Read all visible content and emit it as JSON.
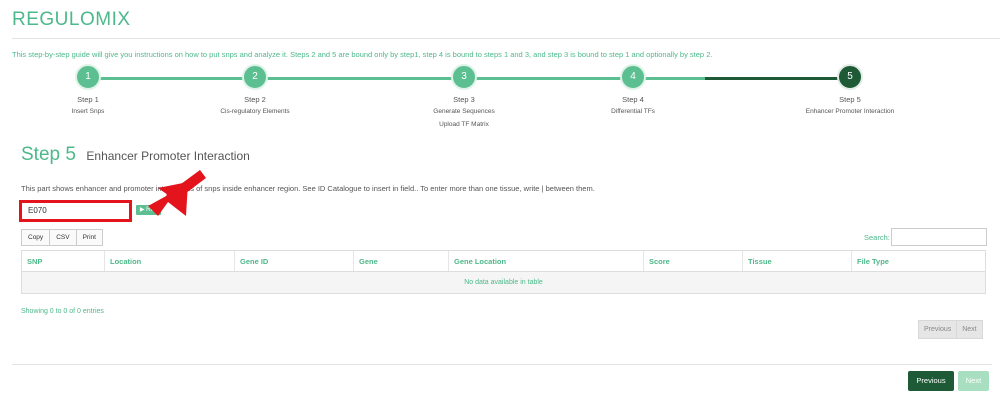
{
  "brand": "REGULOMIX",
  "intro": "This step-by-step guide will give you instructions on how to put snps and analyze it. Steps 2 and 5 are bound only by step1, step 4 is bound to steps 1 and 3, and step 3 is bound to step 1 and optionally by step 2.",
  "steps": [
    {
      "number": "1",
      "label": "Step 1",
      "desc": "Insert Snps",
      "desc2": ""
    },
    {
      "number": "2",
      "label": "Step 2",
      "desc": "Cis-regulatory Elements",
      "desc2": ""
    },
    {
      "number": "3",
      "label": "Step 3",
      "desc": "Generate Sequences",
      "desc2": "Upload TF Matrix"
    },
    {
      "number": "4",
      "label": "Step 4",
      "desc": "Differential TFs",
      "desc2": ""
    },
    {
      "number": "5",
      "label": "Step 5",
      "desc": "Enhancer Promoter Interaction",
      "desc2": ""
    }
  ],
  "active_step": 5,
  "section": {
    "step": "Step 5",
    "title": "Enhancer Promoter Interaction"
  },
  "description": "This part shows enhancer and promoter interactions of snps inside enhancer region. See ID Catalogue to insert in field.. To enter more than one tissue, write | between them.",
  "tissue_input": {
    "value": "E070"
  },
  "run_label": "▶ Run",
  "table_buttons": [
    "Copy",
    "CSV",
    "Print"
  ],
  "search_label": "Search:",
  "columns": [
    "SNP",
    "Location",
    "Gene ID",
    "Gene",
    "Gene Location",
    "Score",
    "Tissue",
    "File Type"
  ],
  "empty_message": "No data available in table",
  "info": "Showing 0 to 0 of 0 entries",
  "pager": {
    "previous": "Previous",
    "next": "Next"
  },
  "wizard": {
    "previous": "Previous",
    "next": "Next"
  },
  "colors": {
    "accent": "#5cbf91",
    "dark": "#1d5a35",
    "highlight": "#e3141c"
  }
}
